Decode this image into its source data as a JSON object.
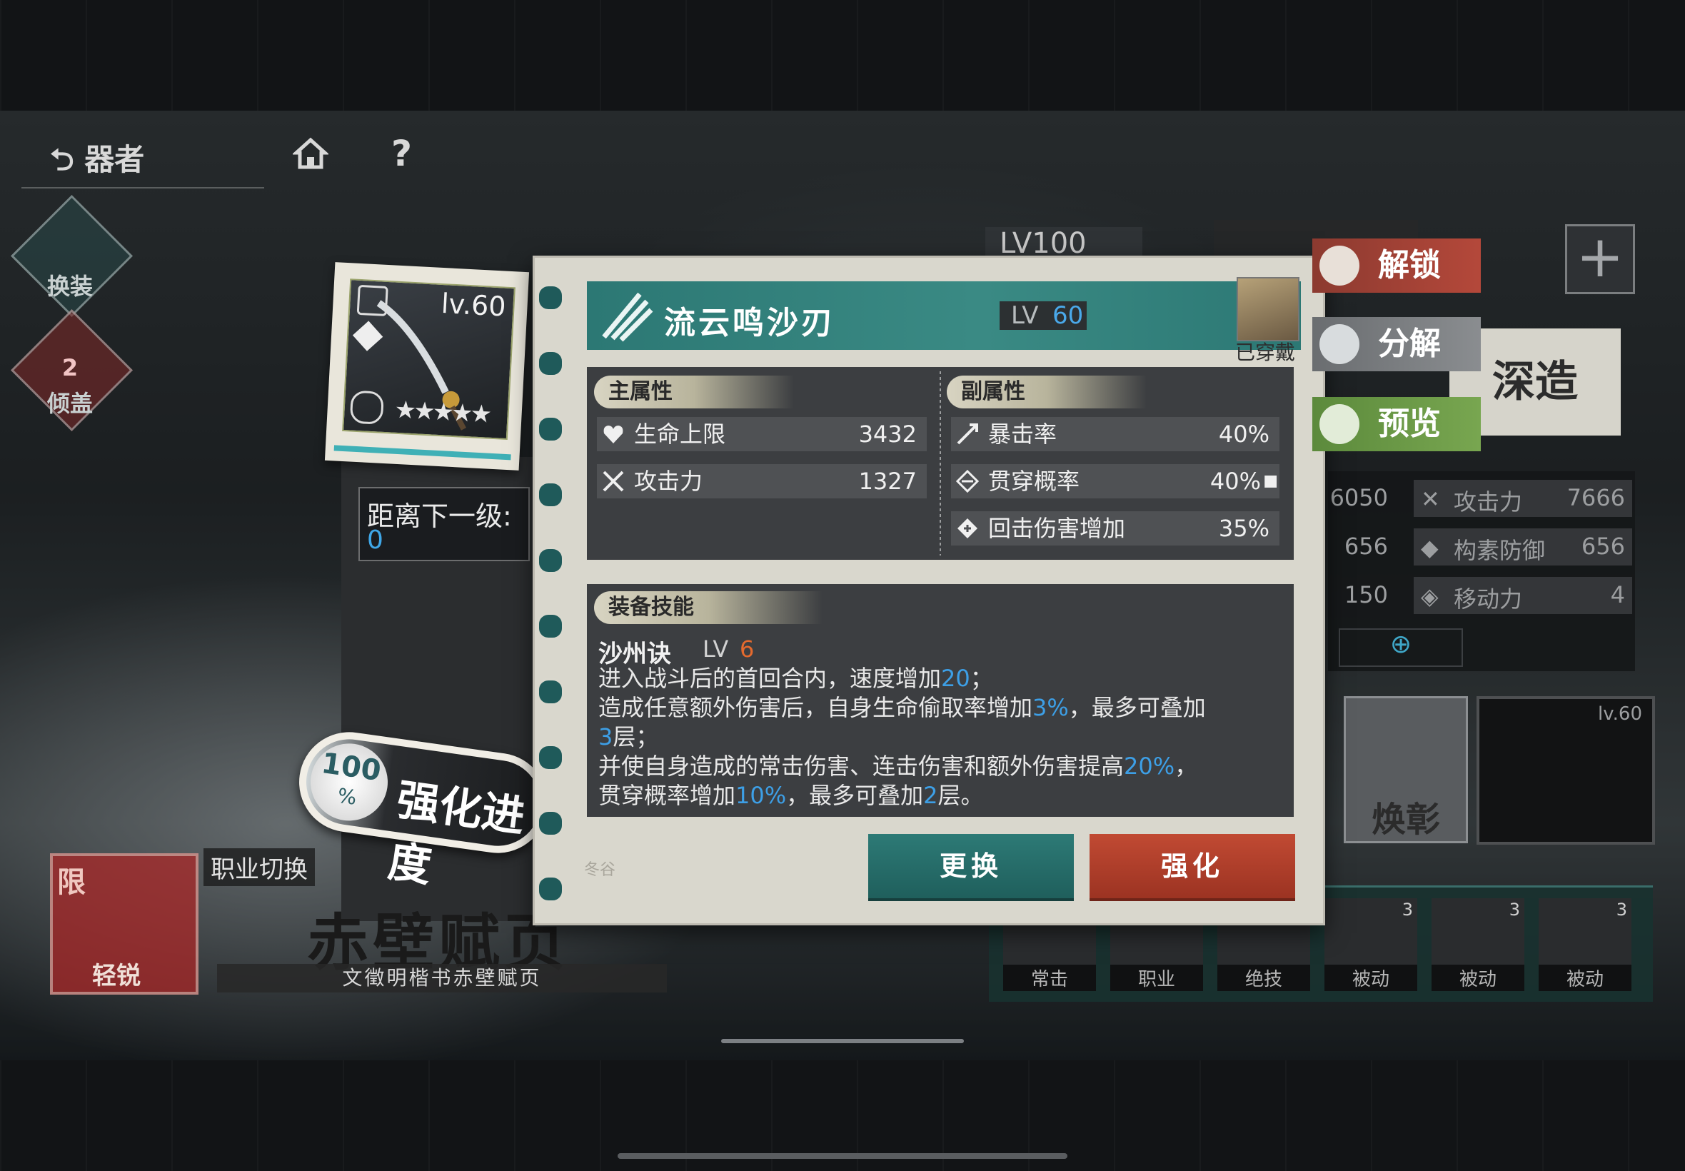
{
  "nav": {
    "back_label": "器者",
    "help_label": "?"
  },
  "side": {
    "change_label": "换装",
    "affection_count": "2",
    "affection_label": "倾盖"
  },
  "item_card": {
    "level": "lv.60"
  },
  "next_level": {
    "label": "距离下一级:",
    "value": "0"
  },
  "progress": {
    "value": "100",
    "unit": "%",
    "label": "强化进度"
  },
  "bottom_left": {
    "class_switch": "职业切换",
    "limit_char": "限",
    "limit_tag": "轻锐",
    "title": "赤壁赋页",
    "subtitle": "文徵明楷书赤壁赋页"
  },
  "panel": {
    "item_name": "流云鸣沙刃",
    "lv_label": "LV",
    "lv_value": "60",
    "equipped_label": "已穿戴",
    "main_attr_title": "主属性",
    "main_attrs": [
      {
        "icon": "heart-shield-icon",
        "name": "生命上限",
        "value": "3432"
      },
      {
        "icon": "crossed-swords-icon",
        "name": "攻击力",
        "value": "1327"
      }
    ],
    "sub_attr_title": "副属性",
    "sub_attrs": [
      {
        "icon": "crit-icon",
        "name": "暴击率",
        "value": "40%"
      },
      {
        "icon": "pierce-icon",
        "name": "贯穿概率",
        "value": "40%"
      },
      {
        "icon": "counter-icon",
        "name": "回击伤害增加",
        "value": "35%"
      }
    ],
    "skill_title": "装备技能",
    "skill_name": "沙州诀",
    "skill_lv_label": "LV",
    "skill_lv_value": "6",
    "skill_desc": [
      [
        "进入战斗后的首回合内，速度增加",
        "20",
        "；"
      ],
      [
        "造成任意额外伤害后，自身生命偷取率增加",
        "3%",
        "，最多可叠加"
      ],
      [
        "",
        "3",
        "层；"
      ],
      [
        "并使自身造成的常击伤害、连击伤害和额外伤害提高",
        "20%",
        "，"
      ],
      [
        "贯穿概率增加",
        "10%",
        "，最多可叠加",
        "2",
        "层。"
      ]
    ],
    "stamp_text": "冬谷",
    "btn_change": "更换",
    "btn_enhance": "强化"
  },
  "actions": {
    "unlock": "解锁",
    "decompose": "分解",
    "preview": "预览"
  },
  "right_bg": {
    "level_badge": "LV100",
    "deep_craft": "深造",
    "stats": [
      {
        "left": "6050",
        "name": "攻击力",
        "value": "7666"
      },
      {
        "left": "656",
        "name": "构素防御",
        "value": "656"
      },
      {
        "left": "150",
        "name": "移动力",
        "value": "4"
      }
    ],
    "huan_label": "焕彰",
    "equip_level": "lv.60",
    "skills": [
      {
        "label": "常击",
        "count": ""
      },
      {
        "label": "职业",
        "count": ""
      },
      {
        "label": "绝技",
        "count": ""
      },
      {
        "label": "被动",
        "count": "3"
      },
      {
        "label": "被动",
        "count": "3"
      },
      {
        "label": "被动",
        "count": "3"
      }
    ]
  },
  "colors": {
    "teal": "#2c7874",
    "red": "#c14a33",
    "highlight_blue": "#3d9fe6",
    "orange": "#e46a2e",
    "green_tag": "#6f9a4a"
  }
}
